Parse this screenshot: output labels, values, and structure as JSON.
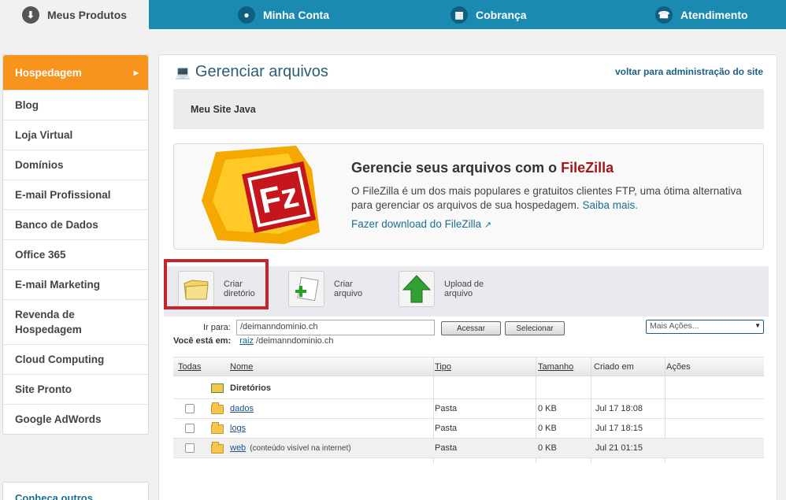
{
  "topnav": {
    "tabs": [
      {
        "label": "Meus Produtos",
        "icon": "download-icon"
      },
      {
        "label": "Minha Conta",
        "icon": "user-icon"
      },
      {
        "label": "Cobrança",
        "icon": "calculator-icon"
      },
      {
        "label": "Atendimento",
        "icon": "support-icon"
      }
    ]
  },
  "sidebar": {
    "items": [
      "Hospedagem",
      "Blog",
      "Loja Virtual",
      "Domínios",
      "E-mail Profissional",
      "Banco de Dados",
      "Office 365",
      "E-mail Marketing",
      "Revenda de Hospedagem",
      "Cloud Computing",
      "Site Pronto",
      "Google AdWords"
    ],
    "more": "Conheça outros"
  },
  "main": {
    "title": "Gerenciar arquivos",
    "back_link": "voltar para administração do site",
    "site_name": "Meu Site Java"
  },
  "promo": {
    "heading_prefix": "Gerencie seus arquivos com o",
    "heading_brand": "FileZilla",
    "text": "O FileZilla é um dos mais populares e gratuitos clientes FTP, uma ótima alternativa para gerenciar os arquivos de sua hospedagem.",
    "more_link": "Saiba mais.",
    "download_link": "Fazer download do FileZilla"
  },
  "toolbar": {
    "create_dir": [
      "Criar",
      "diretório"
    ],
    "create_file": [
      "Criar",
      "arquivo"
    ],
    "upload": [
      "Upload de",
      "arquivo"
    ]
  },
  "goto": {
    "label": "Ir para:",
    "value": "/deimanndominio.ch",
    "access_button": "Acessar",
    "select_button": "Selecionar",
    "more_actions": "Mais Ações..."
  },
  "location": {
    "label": "Você está em:",
    "root": "raiz",
    "path": "/deimanndominio.ch"
  },
  "table": {
    "headers": [
      "Todas",
      "Nome",
      "Tipo",
      "Tamanho",
      "Criado em",
      "Ações"
    ],
    "section": "Diretórios",
    "rows": [
      {
        "name": "dados",
        "note": "",
        "type": "Pasta",
        "size": "0 KB",
        "created": "Jul 17 18:08"
      },
      {
        "name": "logs",
        "note": "",
        "type": "Pasta",
        "size": "0 KB",
        "created": "Jul 17 18:15"
      },
      {
        "name": "web",
        "note": "(conteúdo visível na internet)",
        "type": "Pasta",
        "size": "0 KB",
        "created": "Jul 21 01:15"
      }
    ]
  },
  "colors": {
    "nav": "#1a8ab0",
    "accent": "#f7941d",
    "highlight": "#c4262c"
  }
}
